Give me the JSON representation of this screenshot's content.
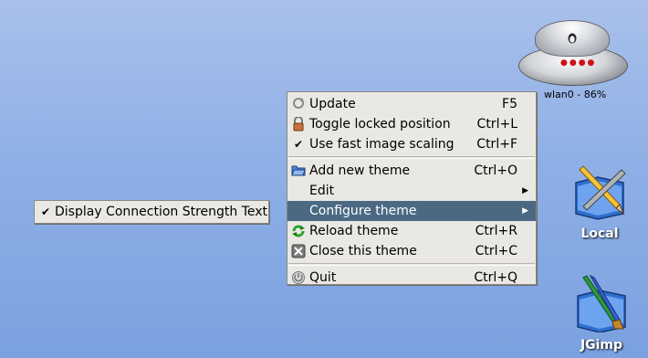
{
  "router": {
    "label": "wlan0 - 86%"
  },
  "desktop_icons": [
    {
      "label": "Local",
      "icon": "pencil-folder-icon"
    },
    {
      "label": "JGimp",
      "icon": "brush-folder-icon"
    }
  ],
  "menu": {
    "items": [
      {
        "label": "Update",
        "accel": "F5",
        "icon": "refresh-icon"
      },
      {
        "label": "Toggle locked position",
        "accel": "Ctrl+L",
        "icon": "lock-icon"
      },
      {
        "label": "Use fast image scaling",
        "accel": "Ctrl+F",
        "icon": "check-icon",
        "checked": true
      },
      {
        "label": "Add new theme",
        "accel": "Ctrl+O",
        "icon": "open-folder-icon"
      },
      {
        "label": "Edit",
        "accel": "",
        "icon": "",
        "submenu": true
      },
      {
        "label": "Configure theme",
        "accel": "",
        "icon": "",
        "submenu": true,
        "highlighted": true
      },
      {
        "label": "Reload theme",
        "accel": "Ctrl+R",
        "icon": "reload-icon"
      },
      {
        "label": "Close this theme",
        "accel": "Ctrl+C",
        "icon": "close-icon"
      },
      {
        "label": "Quit",
        "accel": "Ctrl+Q",
        "icon": "quit-icon"
      }
    ]
  },
  "submenu": {
    "items": [
      {
        "label": "Display Connection Strength Text",
        "checked": true,
        "icon": "check-icon"
      }
    ]
  },
  "colors": {
    "highlight": "#4b6983",
    "menu_bg": "#eae8e3",
    "desktop": "#8fb0e6"
  }
}
